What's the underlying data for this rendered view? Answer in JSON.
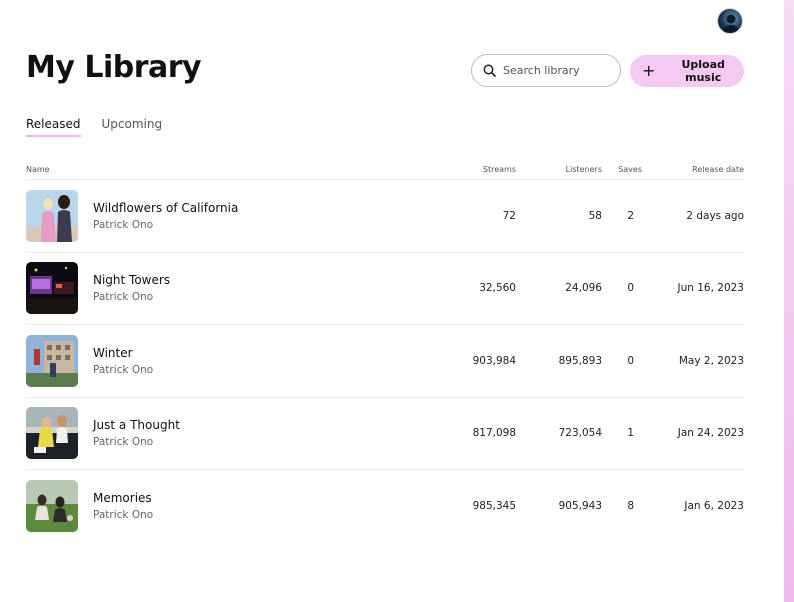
{
  "header": {
    "title": "My Library",
    "search_placeholder": "Search library",
    "upload_label": "Upload music"
  },
  "tabs": [
    {
      "label": "Released",
      "active": true
    },
    {
      "label": "Upcoming",
      "active": false
    }
  ],
  "table": {
    "columns": {
      "name": "Name",
      "streams": "Streams",
      "listeners": "Listeners",
      "saves": "Saves",
      "release_date": "Release date"
    },
    "rows": [
      {
        "title": "Wildflowers of California",
        "artist": "Patrick Ono",
        "streams": "72",
        "listeners": "58",
        "saves": "2",
        "release_date": "2 days ago"
      },
      {
        "title": "Night Towers",
        "artist": "Patrick Ono",
        "streams": "32,560",
        "listeners": "24,096",
        "saves": "0",
        "release_date": "Jun 16, 2023"
      },
      {
        "title": "Winter",
        "artist": "Patrick Ono",
        "streams": "903,984",
        "listeners": "895,893",
        "saves": "0",
        "release_date": "May 2, 2023"
      },
      {
        "title": "Just a Thought",
        "artist": "Patrick Ono",
        "streams": "817,098",
        "listeners": "723,054",
        "saves": "1",
        "release_date": "Jan 24, 2023"
      },
      {
        "title": "Memories",
        "artist": "Patrick Ono",
        "streams": "985,345",
        "listeners": "905,943",
        "saves": "8",
        "release_date": "Jan 6, 2023"
      }
    ]
  },
  "icons": {
    "search": "search-icon",
    "upload": "plus-icon",
    "avatar": "user-avatar"
  },
  "colors": {
    "accent": "#f6c9f3",
    "tab_underline": "#f2b3ee"
  }
}
